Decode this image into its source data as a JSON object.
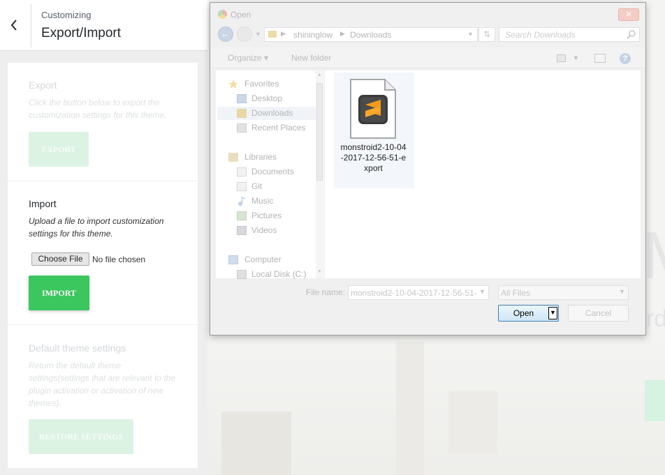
{
  "customizer": {
    "header": {
      "subtitle": "Customizing",
      "title": "Export/Import"
    },
    "export": {
      "title": "Export",
      "description": "Click the button below to export the customization settings for this theme.",
      "button_label": "EXPORT"
    },
    "import": {
      "title": "Import",
      "description": "Upload a file to import customization settings for this theme.",
      "choose_file_label": "Choose File",
      "no_file_text": "No file chosen",
      "button_label": "IMPORT"
    },
    "defaults": {
      "title": "Default theme settings",
      "description": "Return the default theme settings(settings that are relevant to the plugin activation or activation of new themes).",
      "button_label": "RESTORE SETTINGS"
    },
    "accent_color": "#3cc65e"
  },
  "preview": {
    "big_letter": "M",
    "partial_text": "rd"
  },
  "dialog": {
    "title": "Open",
    "close_glyph": "✕",
    "address": {
      "crumbs": [
        "shininglow",
        "Downloads"
      ]
    },
    "search_placeholder": "Search Downloads",
    "toolbar": {
      "organize": "Organize ▾",
      "new_folder": "New folder",
      "help": "?"
    },
    "nav": {
      "favorites": {
        "label": "Favorites",
        "items": [
          {
            "label": "Desktop",
            "icon": "desktop-icon"
          },
          {
            "label": "Downloads",
            "icon": "downloads-folder-icon",
            "selected": true
          },
          {
            "label": "Recent Places",
            "icon": "recent-places-icon"
          }
        ]
      },
      "libraries": {
        "label": "Libraries",
        "items": [
          {
            "label": "Documents",
            "icon": "documents-icon"
          },
          {
            "label": "Git",
            "icon": "git-icon"
          },
          {
            "label": "Music",
            "icon": "music-icon"
          },
          {
            "label": "Pictures",
            "icon": "pictures-icon"
          },
          {
            "label": "Videos",
            "icon": "videos-icon"
          }
        ]
      },
      "computer": {
        "label": "Computer",
        "items": [
          {
            "label": "Local Disk (C:)",
            "icon": "local-disk-icon"
          }
        ]
      }
    },
    "file": {
      "name": "monstroid2-10-04-2017-12-56-51-export",
      "icon": "sublime-text-file-icon"
    },
    "filename_label": "File name:",
    "filename_value": "monstroid2-10-04-2017-12-56-51-",
    "filetype_value": "All Files",
    "open_label": "Open",
    "cancel_label": "Cancel"
  }
}
